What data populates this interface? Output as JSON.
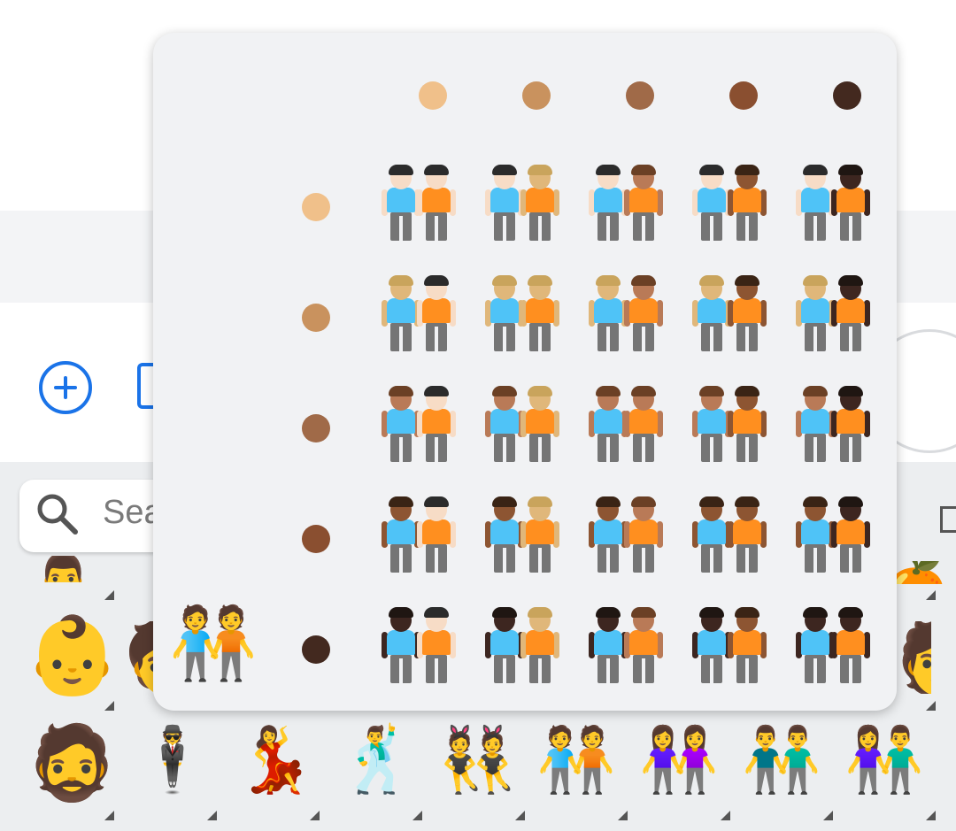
{
  "search": {
    "placeholder": "Sea"
  },
  "popup": {
    "default_emoji": "🧑‍🤝‍🧑",
    "column_tones": [
      "#f0c08a",
      "#c9925e",
      "#a06a48",
      "#8a4f30",
      "#43291f"
    ],
    "row_tones": [
      "#f0c08a",
      "#c9925e",
      "#a06a48",
      "#8a4f30",
      "#43291f"
    ],
    "skin": {
      "light": "#f7dcc6",
      "medium_light": "#e0b77a",
      "medium": "#b97a57",
      "medium_dark": "#8d5532",
      "dark": "#3d2620"
    },
    "hair": {
      "light": "#2b2b2b",
      "medium_light": "#c9a45c",
      "medium": "#6b4025",
      "medium_dark": "#3a2415",
      "dark": "#1f1612"
    },
    "shirt_left": "#4fc3f7",
    "shirt_right": "#ff8f1f"
  },
  "keyboard": {
    "row_partial_icons": [
      "👨‍💼",
      "🎩",
      "🍊"
    ],
    "row_middle": [
      "👶",
      "🧒",
      "🧑‍🤝‍🧑",
      "🧑"
    ],
    "row_bottom": [
      "🧔",
      "🕴️",
      "💃",
      "🕺",
      "👯",
      "🧑‍🤝‍🧑",
      "👭",
      "👬",
      "👫"
    ]
  }
}
